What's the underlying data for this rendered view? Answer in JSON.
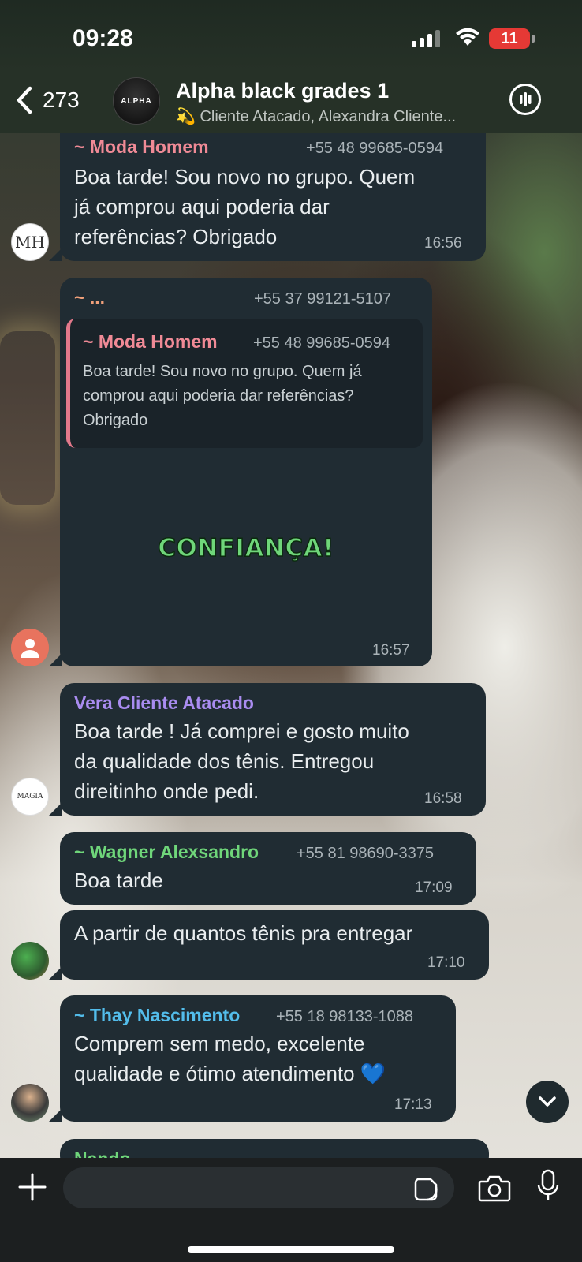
{
  "status_bar": {
    "time": "09:28",
    "battery": "11"
  },
  "header": {
    "back_count": "273",
    "avatar_text": "ALPHA",
    "title": "Alpha black grades 1",
    "subtitle": "💫 Cliente Atacado, Alexandra Cliente..."
  },
  "messages": [
    {
      "sender": "~ Moda Homem",
      "phone": "+55 48 99685-0594",
      "text_lines": [
        "Boa tarde! Sou novo no grupo. Quem",
        "já comprou aqui poderia dar",
        "referências? Obrigado"
      ],
      "time": "16:56",
      "avatar_text": "MH"
    },
    {
      "sender": "~ ...",
      "phone": "+55 37 99121-5107",
      "quote": {
        "sender": "~ Moda Homem",
        "phone": "+55 48 99685-0594",
        "text_lines": [
          "Boa tarde! Sou novo no grupo. Quem já",
          "comprou aqui poderia dar referências?",
          "Obrigado"
        ]
      },
      "sticker_text": "CONFIANÇA!",
      "time": "16:57"
    },
    {
      "sender": "Vera Cliente Atacado",
      "text_lines": [
        "Boa tarde ! Já comprei e gosto muito",
        "da qualidade dos tênis. Entregou",
        "direitinho onde pedi."
      ],
      "time": "16:58",
      "avatar_text": "MAGIA"
    },
    {
      "sender": "~ Wagner Alexsandro",
      "phone": "+55 81 98690-3375",
      "text": "Boa tarde",
      "time": "17:09"
    },
    {
      "text": "A partir de quantos tênis pra entregar",
      "time": "17:10"
    },
    {
      "sender": "~ Thay Nascimento",
      "phone": "+55 18 98133-1088",
      "text_lines": [
        "Comprem sem medo, excelente",
        "qualidade e ótimo atendimento 💙"
      ],
      "time": "17:13"
    },
    {
      "sender": "Nando"
    }
  ],
  "input": {
    "placeholder": ""
  },
  "colors": {
    "bubble": "#202c33",
    "moda_homem": "#f08a96",
    "unknown_sender": "#f0a07a",
    "vera": "#a98cf0",
    "wagner": "#6fd67a",
    "thay": "#53bdeb",
    "nando": "#6fd67a",
    "sticker": "#6fd67a"
  }
}
